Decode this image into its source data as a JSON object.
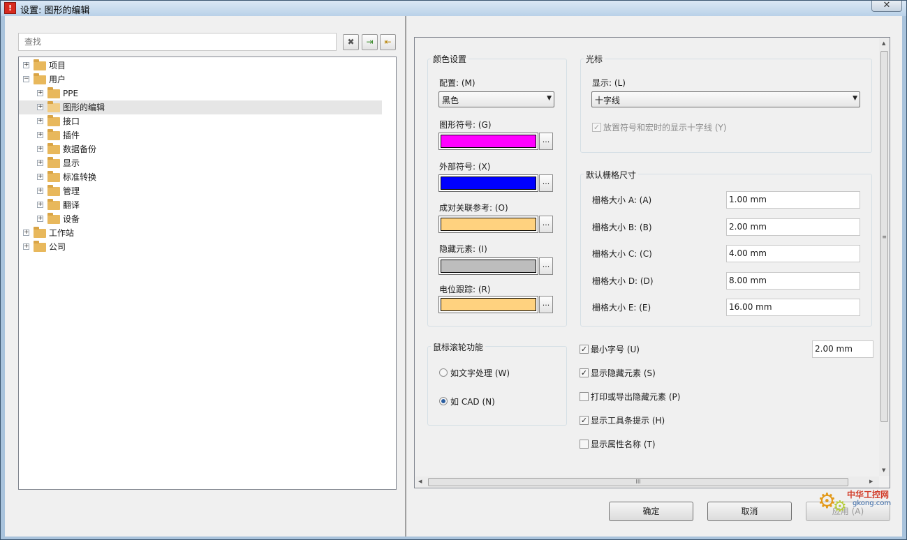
{
  "window": {
    "title": "设置: 图形的编辑",
    "app_icon": "warning-triangle-icon",
    "close_glyph": "✕"
  },
  "left": {
    "search_placeholder": "查找",
    "buttons": [
      {
        "name": "clear-search-button",
        "glyph": "✖",
        "icon": "clear-icon"
      },
      {
        "name": "import-button",
        "glyph": "⇥",
        "icon": "import-icon"
      },
      {
        "name": "export-button",
        "glyph": "⇤",
        "icon": "export-icon"
      }
    ],
    "tree": [
      {
        "label": "项目",
        "level": 0,
        "expanded": false,
        "selected": false
      },
      {
        "label": "用户",
        "level": 0,
        "expanded": true,
        "selected": false
      },
      {
        "label": "PPE",
        "level": 1,
        "expanded": false,
        "selected": false
      },
      {
        "label": "图形的编辑",
        "level": 1,
        "expanded": false,
        "selected": true
      },
      {
        "label": "接口",
        "level": 1,
        "expanded": false,
        "selected": false
      },
      {
        "label": "插件",
        "level": 1,
        "expanded": false,
        "selected": false
      },
      {
        "label": "数据备份",
        "level": 1,
        "expanded": false,
        "selected": false
      },
      {
        "label": "显示",
        "level": 1,
        "expanded": false,
        "selected": false
      },
      {
        "label": "标准转换",
        "level": 1,
        "expanded": false,
        "selected": false
      },
      {
        "label": "管理",
        "level": 1,
        "expanded": false,
        "selected": false
      },
      {
        "label": "翻译",
        "level": 1,
        "expanded": false,
        "selected": false
      },
      {
        "label": "设备",
        "level": 1,
        "expanded": false,
        "selected": false
      },
      {
        "label": "工作站",
        "level": 0,
        "expanded": false,
        "selected": false
      },
      {
        "label": "公司",
        "level": 0,
        "expanded": false,
        "selected": false
      }
    ]
  },
  "colors_group": {
    "title": "颜色设置",
    "config_label": "配置: (M)",
    "config_value": "黑色",
    "items": [
      {
        "label": "图形符号: (G)",
        "color": "#ff00ff"
      },
      {
        "label": "外部符号: (X)",
        "color": "#0000ff"
      },
      {
        "label": "成对关联参考: (O)",
        "color": "#ffd27f"
      },
      {
        "label": "隐藏元素: (I)",
        "color": "#bdbdbd"
      },
      {
        "label": "电位跟踪: (R)",
        "color": "#ffd27f"
      }
    ],
    "more_glyph": "..."
  },
  "cursor_group": {
    "title": "光标",
    "display_label": "显示: (L)",
    "display_value": "十字线",
    "crosshair_option": "放置符号和宏时的显示十字线 (Y)",
    "crosshair_checked": true
  },
  "grid_group": {
    "title": "默认栅格尺寸",
    "rows": [
      {
        "label": "栅格大小 A: (A)",
        "value": "1.00 mm"
      },
      {
        "label": "栅格大小 B: (B)",
        "value": "2.00 mm"
      },
      {
        "label": "栅格大小 C: (C)",
        "value": "4.00 mm"
      },
      {
        "label": "栅格大小 D: (D)",
        "value": "8.00 mm"
      },
      {
        "label": "栅格大小 E: (E)",
        "value": "16.00 mm"
      }
    ]
  },
  "wheel_group": {
    "title": "鼠标滚轮功能",
    "options": [
      {
        "label": "如文字处理 (W)",
        "selected": false
      },
      {
        "label": "如 CAD  (N)",
        "selected": true
      }
    ]
  },
  "options": {
    "min_font_label": "最小字号 (U)",
    "min_font_value": "2.00 mm",
    "checks": [
      {
        "label": "最小字号 (U)",
        "checked": true
      },
      {
        "label": "显示隐藏元素 (S)",
        "checked": true
      },
      {
        "label": "打印或导出隐藏元素 (P)",
        "checked": false
      },
      {
        "label": "显示工具条提示 (H)",
        "checked": true
      },
      {
        "label": "显示属性名称 (T)",
        "checked": false
      }
    ]
  },
  "footer": {
    "ok": "确定",
    "cancel": "取消",
    "apply": "应用 (A)"
  },
  "watermark": {
    "text": "中华工控网",
    "url": "gkong.com"
  }
}
